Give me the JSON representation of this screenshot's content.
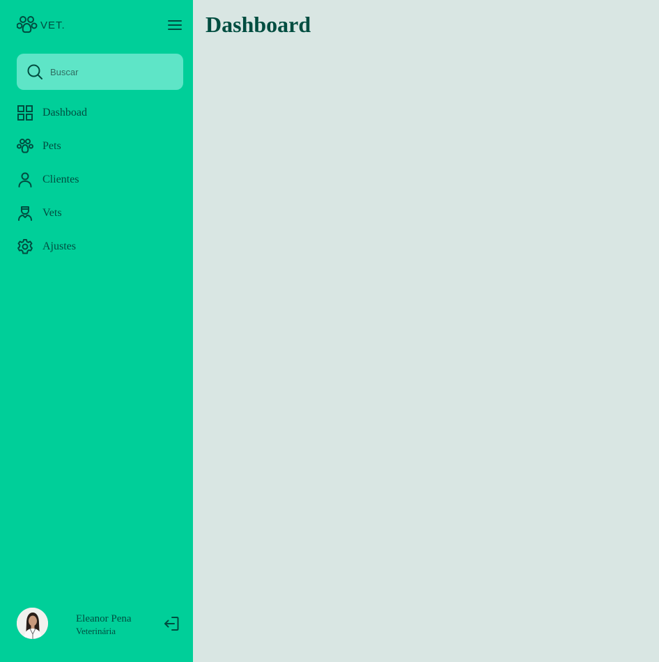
{
  "brand": {
    "name": "VET.",
    "logo_icon": "paw-logo-icon"
  },
  "search": {
    "placeholder": "Buscar",
    "value": ""
  },
  "nav": {
    "items": [
      {
        "label": "Dashboad",
        "icon": "grid-icon"
      },
      {
        "label": "Pets",
        "icon": "paw-icon"
      },
      {
        "label": "Clientes",
        "icon": "user-icon"
      },
      {
        "label": "Vets",
        "icon": "doctor-icon"
      },
      {
        "label": "Ajustes",
        "icon": "gear-icon"
      }
    ]
  },
  "user": {
    "name": "Eleanor Pena",
    "role": "Veterinária"
  },
  "main": {
    "title": "Dashboard"
  },
  "colors": {
    "sidebar": "#00cf99",
    "search_bg": "#5ee5c7",
    "content_bg": "#d9e6e3",
    "text_dark": "#004d40"
  }
}
